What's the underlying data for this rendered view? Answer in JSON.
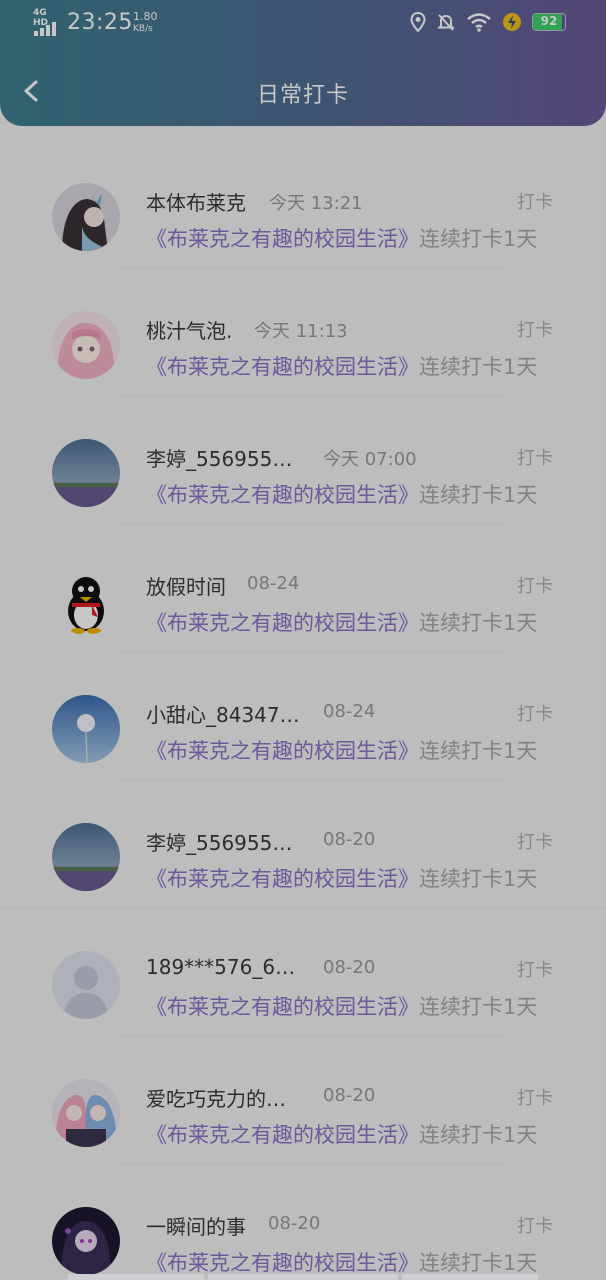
{
  "status_bar": {
    "network": "4G HD",
    "time": "23:25",
    "speed_value": "1.80",
    "speed_unit": "KB/s",
    "battery": "92",
    "icons": [
      "location-icon",
      "bell-off-icon",
      "wifi-icon",
      "charging-icon"
    ]
  },
  "header": {
    "title": "日常打卡",
    "back_icon": "chevron-left-icon"
  },
  "colors": {
    "header_start": "#3f7f8f",
    "header_end": "#6a5a98",
    "book_link": "#8b72c4",
    "muted_text": "#a8a8a8"
  },
  "records": [
    {
      "name": "本体布莱克",
      "time": "今天 13:21",
      "action": "打卡",
      "book": "《布莱克之有趣的校园生活》",
      "streak": "连续打卡1天",
      "avatar": "anime-avatar"
    },
    {
      "name": "桃汁气泡.",
      "time": "今天 11:13",
      "action": "打卡",
      "book": "《布莱克之有趣的校园生活》",
      "streak": "连续打卡1天",
      "avatar": "pink-anime-avatar"
    },
    {
      "name": "李婷_556955…",
      "time": "今天 07:00",
      "action": "打卡",
      "book": "《布莱克之有趣的校园生活》",
      "streak": "连续打卡1天",
      "avatar": "landscape-avatar"
    },
    {
      "name": "放假时间",
      "time": "08-24",
      "action": "打卡",
      "book": "《布莱克之有趣的校园生活》",
      "streak": "连续打卡1天",
      "avatar": "penguin-avatar"
    },
    {
      "name": "小甜心_84347…",
      "time": "08-24",
      "action": "打卡",
      "book": "《布莱克之有趣的校园生活》",
      "streak": "连续打卡1天",
      "avatar": "dandelion-avatar"
    },
    {
      "name": "李婷_556955…",
      "time": "08-20",
      "action": "打卡",
      "book": "《布莱克之有趣的校园生活》",
      "streak": "连续打卡1天",
      "avatar": "landscape-avatar"
    },
    {
      "name": "189***576_6…",
      "time": "08-20",
      "action": "打卡",
      "book": "《布莱克之有趣的校园生活》",
      "streak": "连续打卡1天",
      "avatar": "default-user-avatar"
    },
    {
      "name": "爱吃巧克力的…",
      "time": "08-20",
      "action": "打卡",
      "book": "《布莱克之有趣的校园生活》",
      "streak": "连续打卡1天",
      "avatar": "twins-anime-avatar"
    },
    {
      "name": "一瞬间的事",
      "time": "08-20",
      "action": "打卡",
      "book": "《布莱克之有趣的校园生活》",
      "streak": "连续打卡1天",
      "avatar": "dark-anime-avatar"
    }
  ]
}
